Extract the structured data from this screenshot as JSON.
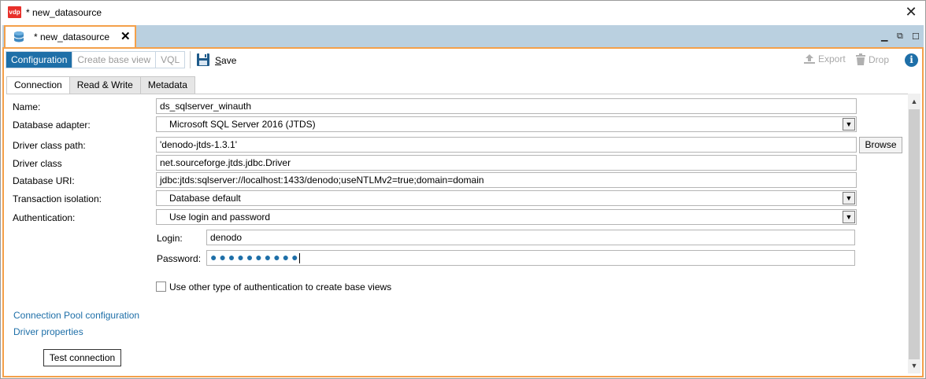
{
  "window": {
    "title": "* new_datasource",
    "logo_text": "vdp"
  },
  "editor_tab": {
    "label": "* new_datasource",
    "close_glyph": "✕"
  },
  "window_controls": {
    "minimize": "▁",
    "restore": "⧉",
    "maximize": "☐"
  },
  "toolbar": {
    "modes": [
      "Configuration",
      "Create base view",
      "VQL"
    ],
    "active_mode": "Configuration",
    "save_label": "Save",
    "export_label": "Export",
    "drop_label": "Drop"
  },
  "subtabs": [
    "Connection",
    "Read & Write",
    "Metadata"
  ],
  "active_subtab": "Connection",
  "form": {
    "name_label": "Name:",
    "name_value": "ds_sqlserver_winauth",
    "adapter_label": "Database adapter:",
    "adapter_value": "Microsoft SQL Server 2016 (JTDS)",
    "classpath_label": "Driver class path:",
    "classpath_value": "'denodo-jtds-1.3.1'",
    "browse_label": "Browse",
    "driver_class_label": "Driver class",
    "driver_class_value": "net.sourceforge.jtds.jdbc.Driver",
    "uri_label": "Database URI:",
    "uri_value": "jdbc:jtds:sqlserver://localhost:1433/denodo;useNTLMv2=true;domain=domain",
    "isolation_label": "Transaction isolation:",
    "isolation_value": "Database default",
    "auth_label": "Authentication:",
    "auth_value": "Use login and password",
    "login_label": "Login:",
    "login_value": "denodo",
    "password_label": "Password:",
    "password_mask": "●●●●●●●●●●",
    "other_auth_label": "Use other type of authentication to create base views",
    "other_auth_checked": false
  },
  "links": {
    "pool": "Connection Pool configuration",
    "driver_props": "Driver properties"
  },
  "test_button": "Test connection",
  "colors": {
    "accent": "#1e6fa8",
    "tab_border": "#f4a04a",
    "tabstrip": "#bad0e0"
  }
}
